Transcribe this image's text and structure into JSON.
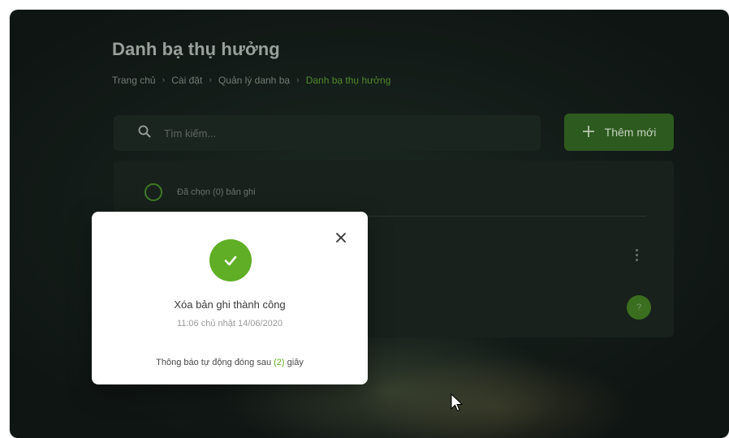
{
  "page": {
    "title": "Danh bạ thụ hưởng"
  },
  "breadcrumb": {
    "items": [
      "Trang chủ",
      "Cài đặt",
      "Quản lý danh bạ"
    ],
    "current": "Danh bạ thụ hưởng",
    "separator": "›"
  },
  "search": {
    "placeholder": "Tìm kiếm...",
    "value": "",
    "icon": "search-icon"
  },
  "toolbar": {
    "add_label": "Thêm mới",
    "add_icon": "plus-icon"
  },
  "list": {
    "selection_text": "Đã chọn (0) bản ghi",
    "badge": "?",
    "more_icon": "more-vertical-icon"
  },
  "toast": {
    "title": "Xóa bản ghi thành công",
    "time": "11:06 chủ nhật 14/06/2020",
    "footer_before": "Thông báo tự động đóng sau",
    "countdown": "(2)",
    "footer_after": "giây",
    "success_icon": "check-icon",
    "close_icon": "close-icon"
  },
  "colors": {
    "accent_green": "#5fae25",
    "button_green": "#2d5a1f",
    "breadcrumb_active": "#4f8a2c",
    "background_dark": "#141d19",
    "toast_bg": "#ffffff"
  }
}
